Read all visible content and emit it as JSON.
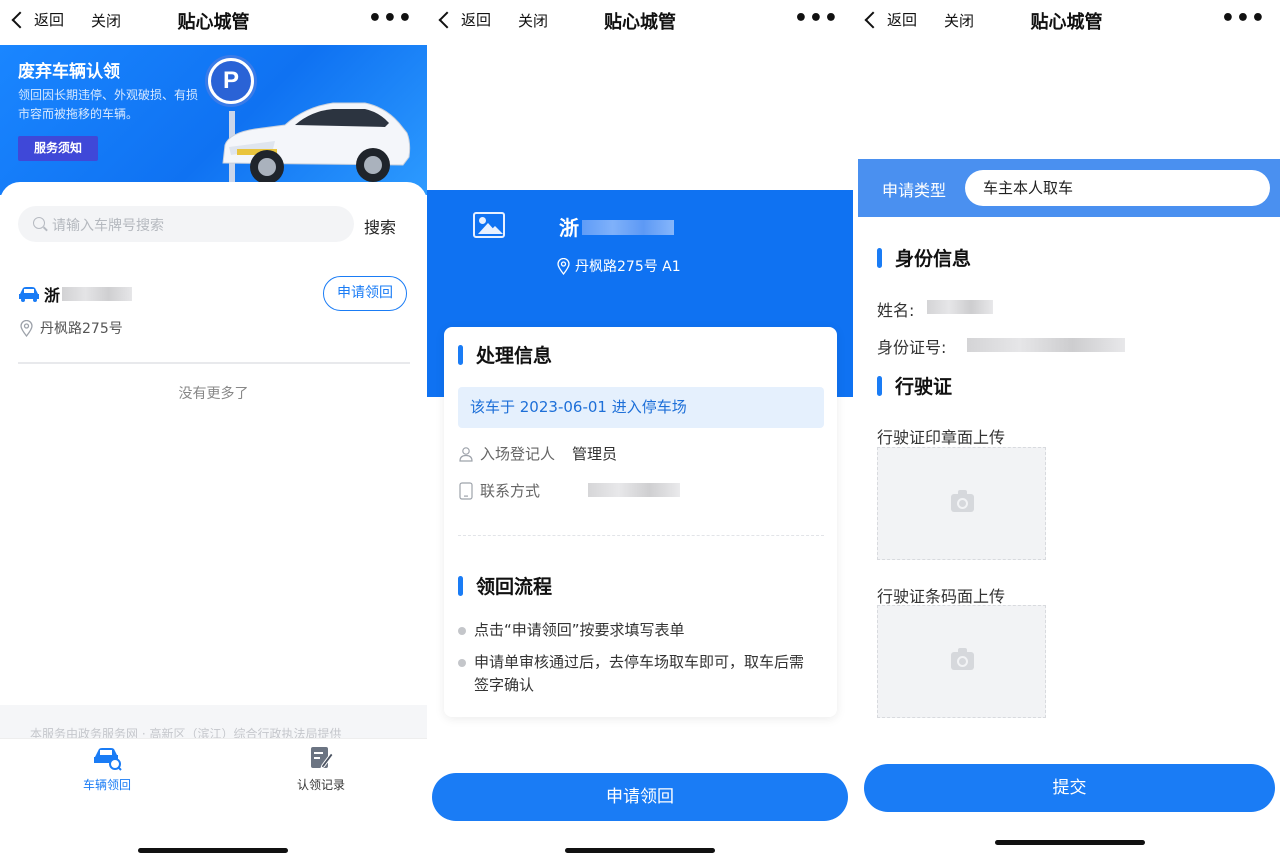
{
  "nav": {
    "back_label": "返回",
    "close_label": "关闭",
    "title": "贴心城管",
    "more": "•••"
  },
  "screen1": {
    "banner": {
      "title": "废弃车辆认领",
      "desc": "领回因长期违停、外观破损、有损市容而被拖移的车辆。",
      "button": "服务须知",
      "sign": "P"
    },
    "search": {
      "placeholder": "请输入车牌号搜索",
      "button": "搜索"
    },
    "record": {
      "plate_prefix": "浙",
      "address": "丹枫路275号",
      "apply_button": "申请领回"
    },
    "no_more": "没有更多了",
    "footnote": "本服务由政务服务网 · 高新区（滨江）综合行政执法局提供",
    "tabs": [
      {
        "label": "车辆领回",
        "icon": "car-search-icon",
        "active": true
      },
      {
        "label": "认领记录",
        "icon": "edit-doc-icon",
        "active": false
      }
    ]
  },
  "screen2": {
    "plate_prefix": "浙",
    "address": "丹枫路275号 A1",
    "section1_title": "处理信息",
    "notice": "该车于 2023-06-01 进入停车场",
    "registrar_label": "入场登记人",
    "registrar_value": "管理员",
    "contact_label": "联系方式",
    "section2_title": "领回流程",
    "steps": [
      "点击“申请领回”按要求填写表单",
      "申请单审核通过后，去停车场取车即可，取车后需签字确认"
    ],
    "submit_button": "申请领回"
  },
  "screen3": {
    "type_label": "申请类型",
    "type_value": "车主本人取车",
    "identity_title": "身份信息",
    "name_label": "姓名:",
    "id_label": "身份证号:",
    "license_title": "行驶证",
    "upload1_label": "行驶证印章面上传",
    "upload2_label": "行驶证条码面上传",
    "submit_button": "提交"
  },
  "colors": {
    "primary": "#1a7cf5",
    "banner": "#0f72f2",
    "band": "#4a90f0",
    "notice_bg": "#e5f0fd"
  }
}
